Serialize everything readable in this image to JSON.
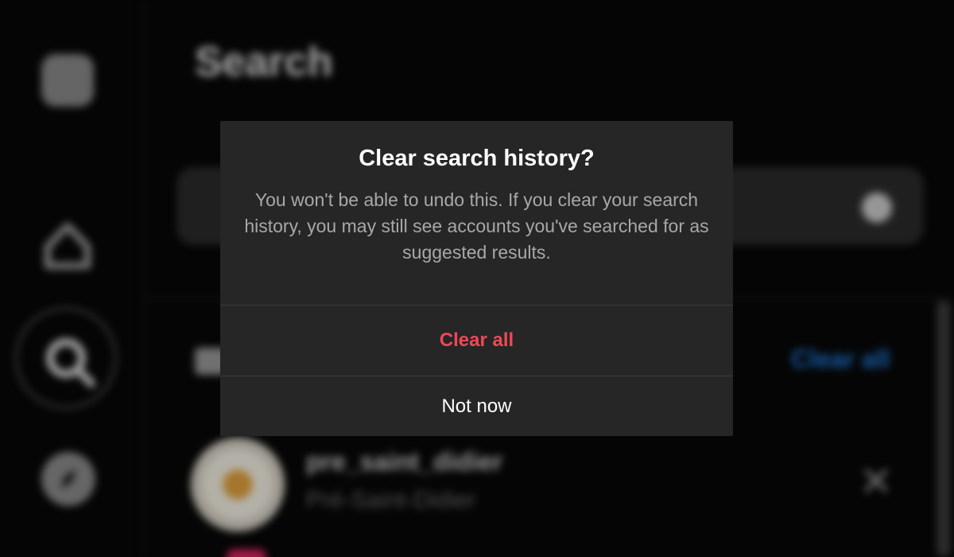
{
  "background": {
    "panel_title": "Search",
    "recent_clear_all": "Clear all",
    "recent_result": {
      "username": "pre_saint_didier",
      "full_name": "Pré-Saint-Didier"
    }
  },
  "dialog": {
    "title": "Clear search history?",
    "body": "You won't be able to undo this. If you clear your search history, you may still see accounts you've searched for as suggested results.",
    "confirm_label": "Clear all",
    "cancel_label": "Not now"
  },
  "colors": {
    "destructive": "#ed4956",
    "dialog_background": "#262626",
    "link_blue": "#1d7ddf"
  },
  "icons": [
    "instagram-logo-icon",
    "home-icon",
    "search-icon",
    "compass-icon",
    "close-icon"
  ]
}
